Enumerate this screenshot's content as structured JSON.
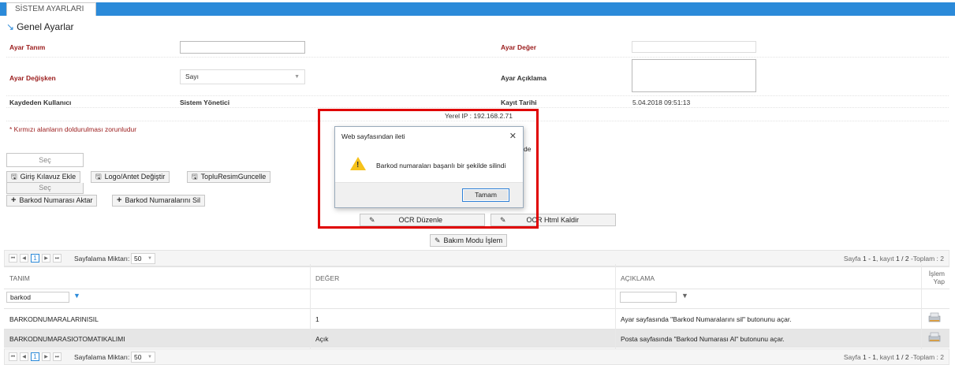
{
  "tab": {
    "label": "SİSTEM AYARLARI"
  },
  "section": {
    "title": "Genel Ayarlar"
  },
  "form": {
    "ayar_tanim_label": "Ayar Tanım",
    "ayar_deger_label": "Ayar Değer",
    "ayar_degisken_label": "Ayar Değişken",
    "ayar_degisken_value": "Sayı",
    "ayar_aciklama_label": "Ayar Açıklama",
    "kaydeden_label": "Kaydeden Kullanıcı",
    "kaydeden_value": "Sistem Yönetici",
    "kayit_tarihi_label": "Kayıt Tarihi",
    "kayit_tarihi_value": "5.04.2018 09:51:13",
    "yerel_ip": "Yerel IP : 192.168.2.71",
    "required_note": "* Kırmızı alanların doldurulması zorunludur"
  },
  "actions": {
    "sec1": "Seç",
    "giris_kilavuz": "Giriş Kılavuz Ekle",
    "logo_antet": "Logo/Antet Değiştir",
    "toplu_resim": "TopluResimGuncelle",
    "sec2": "Seç",
    "barkod_aktar": "Barkod Numarası Aktar",
    "barkod_sil": "Barkod Numaralarını Sil",
    "ocr_duzenle": "OCR Düzenle",
    "ocr_html_kaldir": "OCR Html Kaldir",
    "bakim_modu": "Bakım Modu İşlem",
    "partial_text": "de"
  },
  "dialog": {
    "title": "Web sayfasından ileti",
    "message": "Barkod numaraları başarılı bir şekilde silindi",
    "ok": "Tamam"
  },
  "pager": {
    "current_page": "1",
    "size_label": "Sayfalama Miktarı:",
    "size_value": "50",
    "info_prefix": "Sayfa ",
    "info_range": "1 - 1",
    "info_mid": ", kayıt ",
    "info_records": "1 / 2",
    "info_suffix": " -Toplam : 2"
  },
  "table": {
    "headers": {
      "tanim": "TANIM",
      "deger": "DEĞER",
      "aciklama": "AÇIKLAMA",
      "islem": "İşlem Yap"
    },
    "filter_tanim": "barkod",
    "rows": [
      {
        "tanim": "BARKODNUMARALARINISIL",
        "deger": "1",
        "aciklama": "Ayar sayfasında \"Barkod Numaralarını sil\" butonunu açar."
      },
      {
        "tanim": "BARKODNUMARASIOTOMATIKALIMI",
        "deger": "Açık",
        "aciklama": "Posta sayfasında \"Barkod Numarası Al\" butonunu açar."
      }
    ]
  },
  "colors": {
    "accent": "#2b8ad9",
    "required_label": "#9a1b1b",
    "highlight_box": "#e00000",
    "warning": "#f6c21b"
  }
}
